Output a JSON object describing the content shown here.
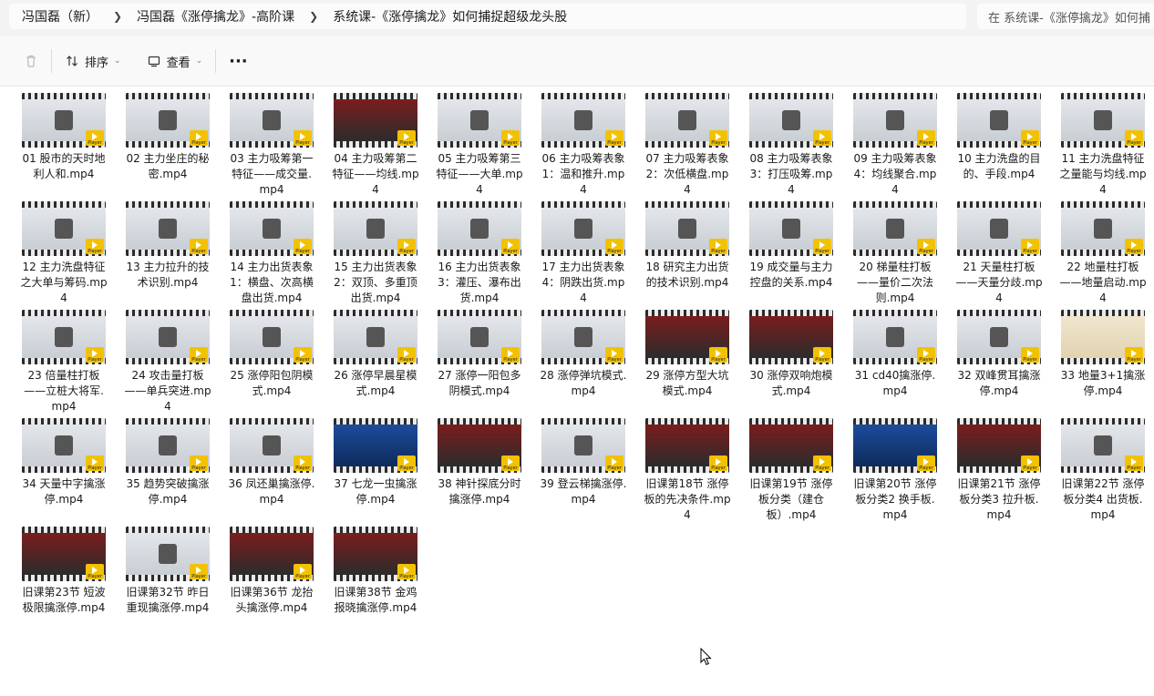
{
  "breadcrumb": [
    "冯国磊（新）",
    "冯国磊《涨停擒龙》-高阶课",
    "系统课-《涨停擒龙》如何捕捉超级龙头股"
  ],
  "search": {
    "placeholder": "在 系统课-《涨停擒龙》如何捕"
  },
  "toolbar": {
    "sort_label": "排序",
    "view_label": "查看",
    "more_label": "···"
  },
  "badge_text": "Player",
  "files": [
    {
      "label": "01 股市的天时地利人和.mp4",
      "style": "gray"
    },
    {
      "label": "02 主力坐庄的秘密.mp4",
      "style": "gray"
    },
    {
      "label": "03 主力吸筹第一特征——成交量.mp4",
      "style": "gray"
    },
    {
      "label": "04 主力吸筹第二特征——均线.mp4",
      "style": "red"
    },
    {
      "label": "05 主力吸筹第三特征——大单.mp4",
      "style": "gray"
    },
    {
      "label": "06 主力吸筹表象1：温和推升.mp4",
      "style": "gray"
    },
    {
      "label": "07 主力吸筹表象2：次低横盘.mp4",
      "style": "gray"
    },
    {
      "label": "08 主力吸筹表象3：打压吸筹.mp4",
      "style": "gray"
    },
    {
      "label": "09 主力吸筹表象4：均线聚合.mp4",
      "style": "gray"
    },
    {
      "label": "10 主力洗盘的目的、手段.mp4",
      "style": "gray"
    },
    {
      "label": "11 主力洗盘特征之量能与均线.mp4",
      "style": "gray"
    },
    {
      "label": "12 主力洗盘特征之大单与筹码.mp4",
      "style": "gray"
    },
    {
      "label": "13 主力拉升的技术识别.mp4",
      "style": "gray"
    },
    {
      "label": "14 主力出货表象1：横盘、次高横盘出货.mp4",
      "style": "gray"
    },
    {
      "label": "15 主力出货表象2：双顶、多重顶出货.mp4",
      "style": "gray"
    },
    {
      "label": "16 主力出货表象3：灌压、瀑布出货.mp4",
      "style": "gray"
    },
    {
      "label": "17 主力出货表象4：阴跌出货.mp4",
      "style": "gray"
    },
    {
      "label": "18 研究主力出货的技术识别.mp4",
      "style": "gray"
    },
    {
      "label": "19 成交量与主力控盘的关系.mp4",
      "style": "gray"
    },
    {
      "label": "20 梯量柱打板——量价二次法则.mp4",
      "style": "gray"
    },
    {
      "label": "21 天量柱打板——天量分歧.mp4",
      "style": "gray"
    },
    {
      "label": "22 地量柱打板——地量启动.mp4",
      "style": "gray"
    },
    {
      "label": "23 倍量柱打板——立桩大将军.mp4",
      "style": "gray"
    },
    {
      "label": "24 攻击量打板——单兵突进.mp4",
      "style": "gray"
    },
    {
      "label": "25 涨停阳包阴模式.mp4",
      "style": "gray"
    },
    {
      "label": "26 涨停早晨星模式.mp4",
      "style": "gray"
    },
    {
      "label": "27 涨停一阳包多阴模式.mp4",
      "style": "gray"
    },
    {
      "label": "28 涨停弹坑模式.mp4",
      "style": "gray"
    },
    {
      "label": "29 涨停方型大坑模式.mp4",
      "style": "red"
    },
    {
      "label": "30 涨停双响炮模式.mp4",
      "style": "red"
    },
    {
      "label": "31 cd40擒涨停.mp4",
      "style": "gray"
    },
    {
      "label": "32 双峰贯耳擒涨停.mp4",
      "style": "gray"
    },
    {
      "label": "33 地量3+1擒涨停.mp4",
      "style": "cream"
    },
    {
      "label": "34 天量中字擒涨停.mp4",
      "style": "gray"
    },
    {
      "label": "35 趋势突破擒涨停.mp4",
      "style": "gray"
    },
    {
      "label": "36 凤还巢擒涨停.mp4",
      "style": "gray"
    },
    {
      "label": "37 七龙一虫擒涨停.mp4",
      "style": "blue"
    },
    {
      "label": "38 神针探底分时擒涨停.mp4",
      "style": "red"
    },
    {
      "label": "39 登云梯擒涨停.mp4",
      "style": "gray"
    },
    {
      "label": "旧课第18节 涨停板的先决条件.mp4",
      "style": "red"
    },
    {
      "label": "旧课第19节 涨停板分类（建仓板）.mp4",
      "style": "red"
    },
    {
      "label": "旧课第20节 涨停板分类2 换手板.mp4",
      "style": "blue"
    },
    {
      "label": "旧课第21节 涨停板分类3 拉升板.mp4",
      "style": "red"
    },
    {
      "label": "旧课第22节 涨停板分类4 出货板.mp4",
      "style": "gray"
    },
    {
      "label": "旧课第23节 短波极限擒涨停.mp4",
      "style": "red"
    },
    {
      "label": "旧课第32节 昨日重现擒涨停.mp4",
      "style": "gray"
    },
    {
      "label": "旧课第36节 龙抬头擒涨停.mp4",
      "style": "red"
    },
    {
      "label": "旧课第38节 金鸡报晓擒涨停.mp4",
      "style": "red"
    }
  ]
}
